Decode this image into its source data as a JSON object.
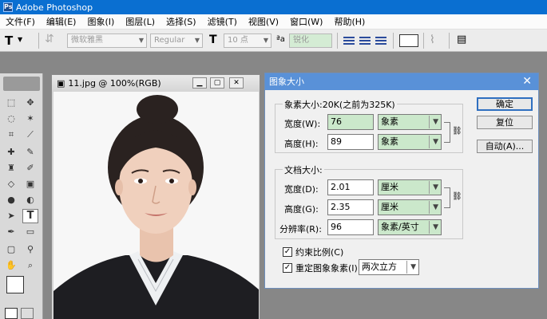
{
  "window": {
    "title": "Adobe Photoshop",
    "logo": "Ps"
  },
  "menu": [
    "文件(F)",
    "编辑(E)",
    "图象(I)",
    "图层(L)",
    "选择(S)",
    "滤镜(T)",
    "视图(V)",
    "窗口(W)",
    "帮助(H)"
  ],
  "options": {
    "tool_glyph": "T",
    "font_family": "微软雅黑",
    "font_style": "Regular",
    "font_size": "10 点",
    "aa_glyph": "ªa",
    "antialias": "锐化"
  },
  "document": {
    "title": "11.jpg @ 100%(RGB)"
  },
  "dialog": {
    "title": "图象大小",
    "pixel_group_label": "象素大小:20K(之前为325K)",
    "width_label": "宽度(W):",
    "width_value": "76",
    "width_unit": "象素",
    "height_label": "高度(H):",
    "height_value": "89",
    "height_unit": "象素",
    "doc_group_label": "文档大小:",
    "doc_width_label": "宽度(D):",
    "doc_width_value": "2.01",
    "doc_width_unit": "厘米",
    "doc_height_label": "高度(G):",
    "doc_height_value": "2.35",
    "doc_height_unit": "厘米",
    "resolution_label": "分辨率(R):",
    "resolution_value": "96",
    "resolution_unit": "象素/英寸",
    "constrain_label": "约束比例(C)",
    "resample_label": "重定图象象素(I):",
    "resample_method": "两次立方",
    "ok_label": "确定",
    "reset_label": "复位",
    "auto_label": "自动(A)...",
    "check_mark": "✓"
  },
  "colors": {
    "titlebar": "#0a6fd1",
    "dialog_title": "#5991d8",
    "field_highlight": "#cbe8cb"
  }
}
